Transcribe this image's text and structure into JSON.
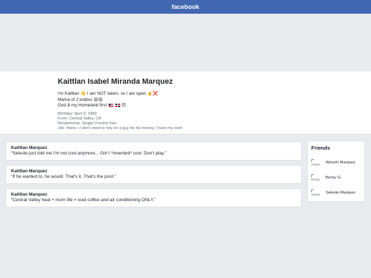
{
  "header": {
    "brand": "facebook",
    "brand_color": "#4267b2"
  },
  "profile": {
    "name": "Kaittlan Isabel Miranda Marquez",
    "bio_line1": "I'm Kaittlan 👋 I am NOT taken, so I am open ☝️❌",
    "bio_line2": "Mama of 2 kiddos 😩😩",
    "bio_line3": "God & my Homeland first",
    "bio_line3_emoji": "😍",
    "birthday": "Birthday: April 5, 1989",
    "from": "From: Central Valley, CA",
    "relationship": "Relationship: Single! Freshly free.",
    "job": "Job: None—I don't need to rely on a guy for his money, I have my own!"
  },
  "posts": [
    {
      "author": "Kaittlan Marquez",
      "text": "“Seleste just told me I'm not cool anymore... Girl I *invented* cool. Don't play.”"
    },
    {
      "author": "Kaittlan Marquez",
      "text": "“If he wanted to, he would. That's it. That's the post.”"
    },
    {
      "author": "Kaittlan Marquez",
      "text": "“Central Valley heat + mom life = iced coffee and air conditioning ONLY.”"
    }
  ],
  "friends": {
    "title": "Friends",
    "items": [
      {
        "avatar_alt": "Aleiye",
        "name": "Aleiyeh Marquez"
      },
      {
        "avatar_alt": "Becky",
        "name": "Becky G."
      },
      {
        "avatar_alt": "Selest",
        "name": "Seleste Marquez"
      }
    ]
  }
}
